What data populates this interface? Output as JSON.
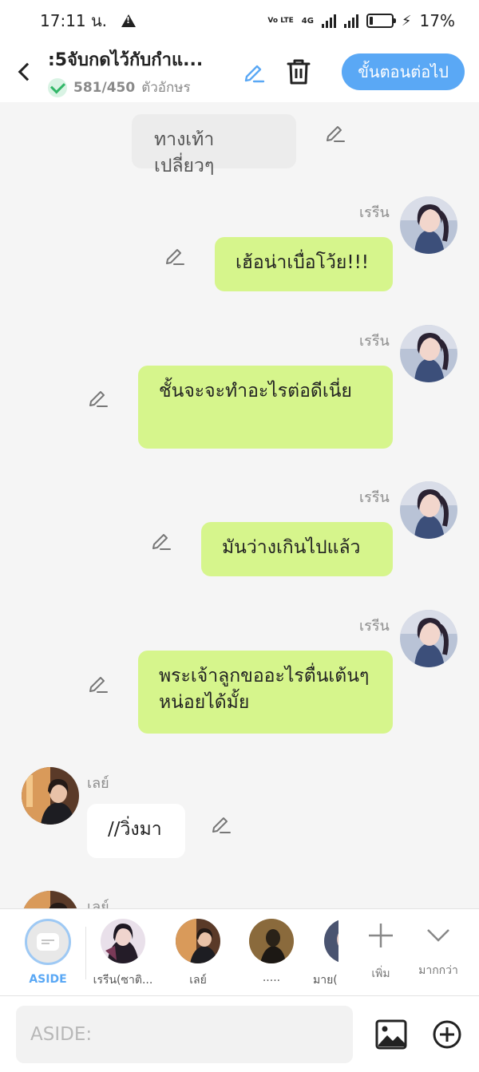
{
  "status_bar": {
    "time": "17:11 น.",
    "volte": "Vo LTE",
    "network": "4G",
    "battery_text": "17%",
    "battery_level": 0.17
  },
  "header": {
    "title": ":5จับกดไว้กับกำแ...",
    "char_count": "581/450",
    "char_unit": "ตัวอักษร",
    "next_button": "ขั้นตอนต่อไป"
  },
  "chat": {
    "messages": [
      {
        "speaker": "",
        "text": "ทางเท้าเปลี่ยวๆ",
        "style": "aside"
      },
      {
        "speaker": "เรรีน",
        "text": "เฮ้อน่าเบื่อโว้ย!!!",
        "side": "right"
      },
      {
        "speaker": "เรรีน",
        "text": "ชั้นจะจะทำอะไรต่อดีเนี่ย",
        "side": "right"
      },
      {
        "speaker": "เรรีน",
        "text": "มันว่างเกินไปแล้ว",
        "side": "right"
      },
      {
        "speaker": "เรรีน",
        "text": "พระเจ้าลูกขออะไรตื่นเต้นๆหน่อยได้มั้ย",
        "side": "right"
      },
      {
        "speaker": "เลย์",
        "text": "//วิ่งมา",
        "side": "left"
      },
      {
        "speaker": "เลย์",
        "text": "",
        "side": "left"
      }
    ]
  },
  "characters": [
    {
      "label": "ASIDE",
      "selected": true
    },
    {
      "label": "เรรีน(ซาติ..."
    },
    {
      "label": "เลย์"
    },
    {
      "label": "....."
    },
    {
      "label": "มาย("
    }
  ],
  "tools": {
    "add_label": "เพิ่ม",
    "more_label": "มากกว่า"
  },
  "input": {
    "placeholder": "ASIDE:",
    "value": ""
  },
  "colors": {
    "accent": "#5aa8f5",
    "bubble_green": "#d6f58c",
    "check": "#32b768"
  }
}
